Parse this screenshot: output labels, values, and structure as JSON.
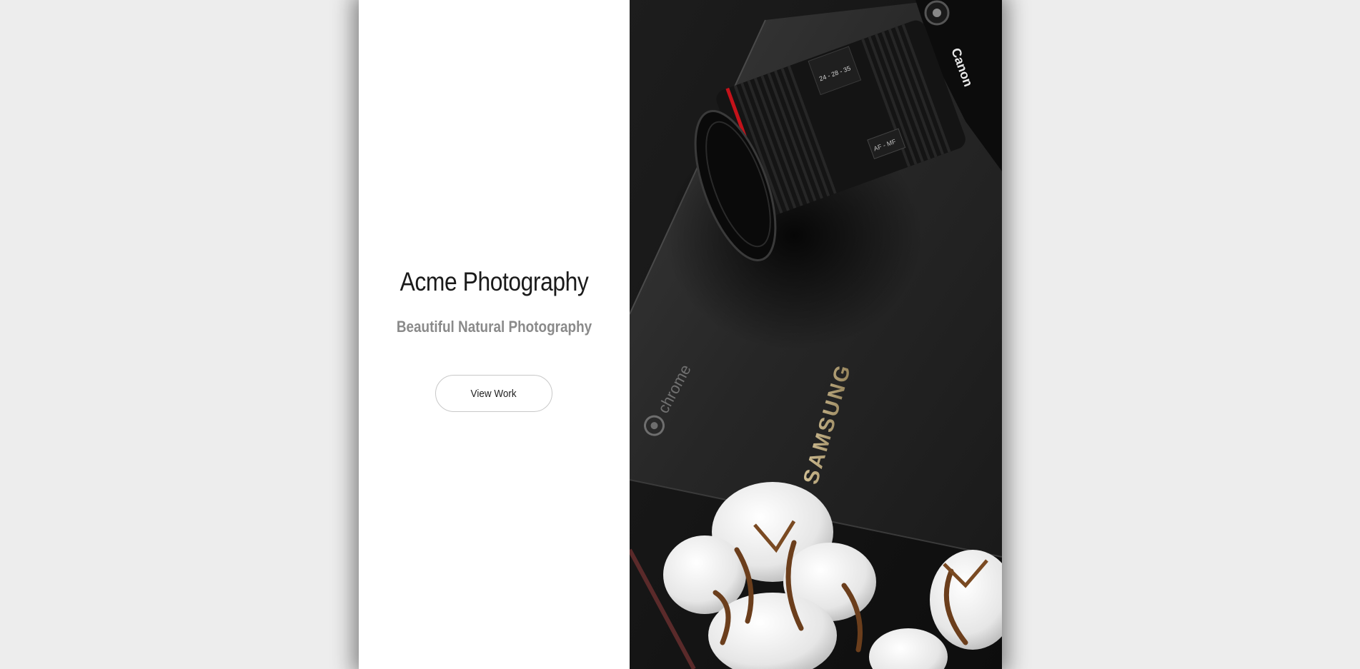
{
  "hero": {
    "title": "Acme Photography",
    "subtitle": "Beautiful Natural Photography",
    "cta_label": "View Work"
  },
  "photo": {
    "laptop_brand": "SAMSUNG",
    "laptop_os": "chrome",
    "camera_brand": "Canon",
    "lens_ring_text": "24 - 28 - 35",
    "lens_switch_text": "AF - MF"
  },
  "colors": {
    "page_bg": "#ededed",
    "panel_bg": "#ffffff",
    "title": "#1a1a1a",
    "subtitle": "#8a8a8a",
    "button_border": "#c8c8c8",
    "photo_bg": "#151515",
    "lens_accent": "#c4121a"
  }
}
